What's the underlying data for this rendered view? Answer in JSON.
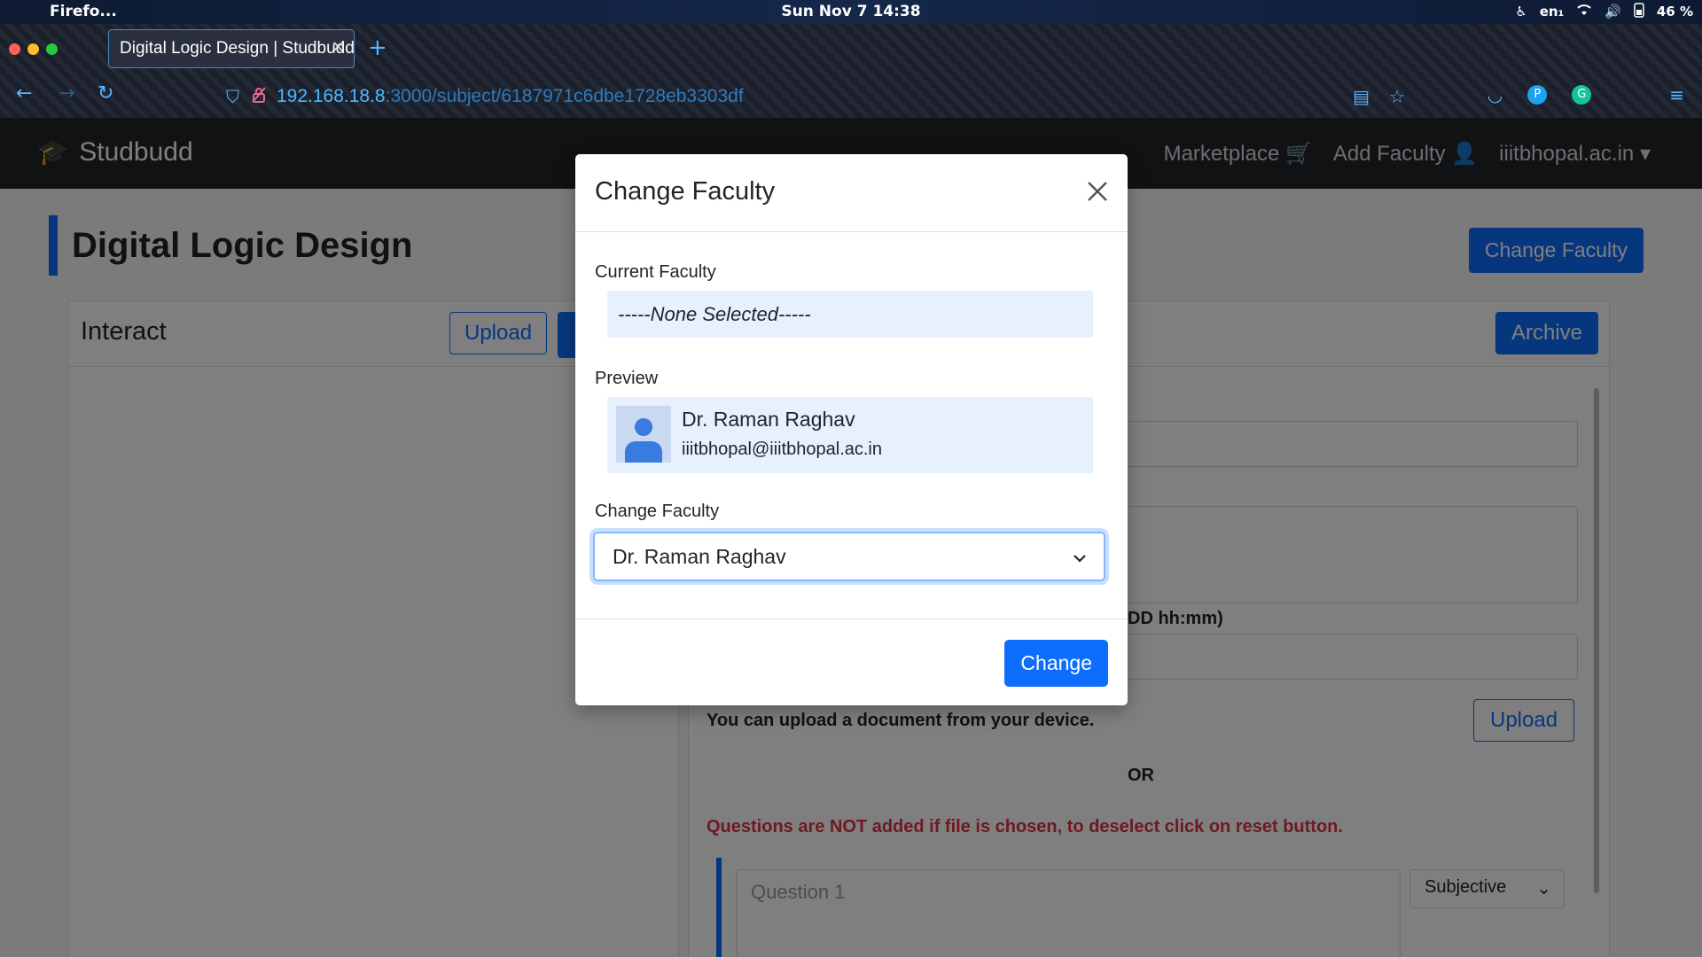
{
  "menubar": {
    "app_name": "Firefo...",
    "clock": "Sun Nov 7  14:38",
    "input_lang": "en₁",
    "battery": "46 %"
  },
  "browser": {
    "tab_title": "Digital Logic Design | Studbudd",
    "url_host": "192.168.18.8",
    "url_path": ":3000/subject/6187971c6dbe1728eb3303df"
  },
  "navbar": {
    "brand": "Studbudd",
    "links": [
      "Marketplace",
      "Add Faculty",
      "iiitbhopal.ac.in"
    ]
  },
  "page": {
    "title": "Digital Logic Design",
    "change_faculty_btn": "Change Faculty",
    "interact_title": "Interact",
    "upload_btn": "Upload",
    "archive_btn": "Archive",
    "date_hint_tail": "DD hh:mm",
    "upload_hint": "You can upload a document from your device.",
    "upload_btn2": "Upload",
    "or_text": "OR",
    "warning": "Questions are NOT added if file is chosen, to deselect click on reset button.",
    "question_placeholder": "Question 1",
    "question_type": "Subjective"
  },
  "modal": {
    "title": "Change Faculty",
    "current_label": "Current Faculty",
    "current_value": "-----None Selected-----",
    "preview_label": "Preview",
    "preview_name": "Dr. Raman Raghav",
    "preview_email": "iiitbhopal@iiitbhopal.ac.in",
    "select_label": "Change Faculty",
    "select_value": "Dr. Raman Raghav",
    "submit": "Change"
  },
  "colors": {
    "primary": "#0d6efd",
    "danger": "#dc3545",
    "navbar_bg": "#212529",
    "preview_bg": "#e7f0fd"
  }
}
